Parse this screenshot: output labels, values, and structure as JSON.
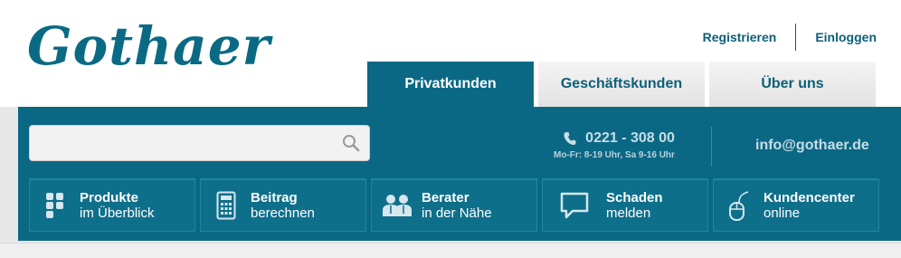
{
  "brand": {
    "logo_text": "Gothaer"
  },
  "toplinks": {
    "register": "Registrieren",
    "login": "Einloggen"
  },
  "tabs": [
    {
      "label": "Privatkunden",
      "active": true
    },
    {
      "label": "Geschäftskunden",
      "active": false
    },
    {
      "label": "Über uns",
      "active": false
    }
  ],
  "search": {
    "value": "",
    "placeholder": ""
  },
  "contact": {
    "phone": "0221 - 308 00",
    "hours": "Mo-Fr: 8-19 Uhr, Sa 9-16 Uhr",
    "email": "info@gothaer.de"
  },
  "nav": [
    {
      "line1": "Produkte",
      "line2": "im Überblick",
      "icon": "grid-icon"
    },
    {
      "line1": "Beitrag",
      "line2": "berechnen",
      "icon": "calculator-icon"
    },
    {
      "line1": "Berater",
      "line2": "in der Nähe",
      "icon": "people-icon"
    },
    {
      "line1": "Schaden",
      "line2": "melden",
      "icon": "speech-bubble-icon"
    },
    {
      "line1": "Kundencenter",
      "line2": "online",
      "icon": "mouse-icon"
    }
  ],
  "colors": {
    "brand": "#0b6884",
    "text_link": "#0b5f7a"
  }
}
